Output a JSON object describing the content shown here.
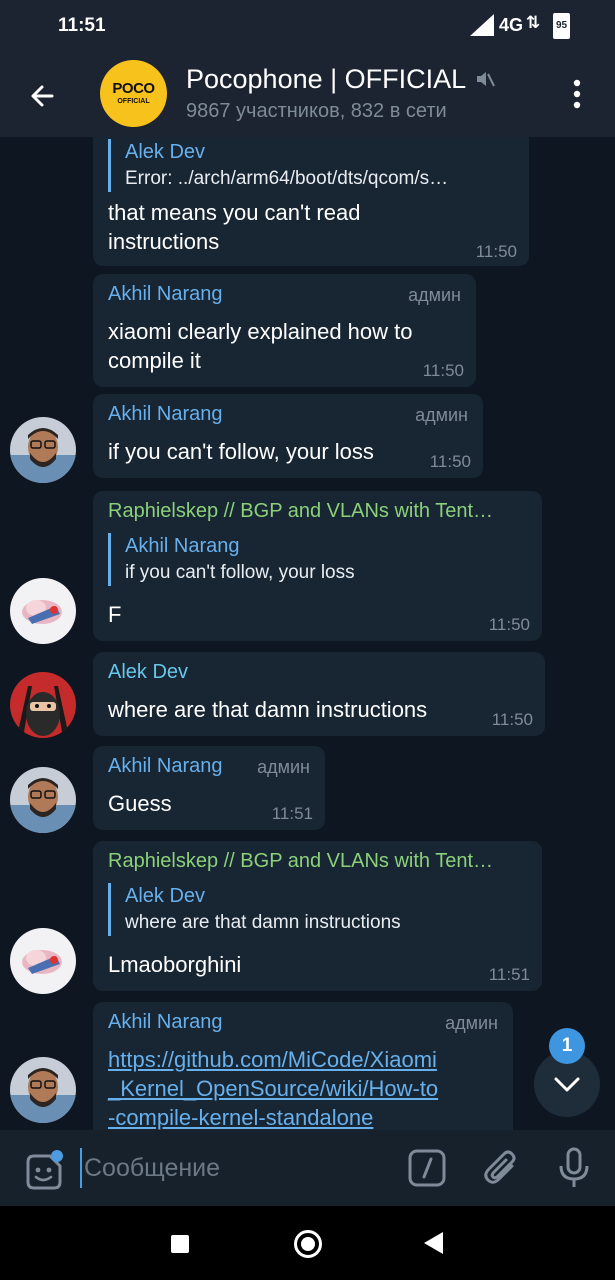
{
  "status_bar": {
    "time": "11:51",
    "network": "4G",
    "battery": "95"
  },
  "header": {
    "title": "Pocophone | OFFICIAL",
    "subtitle": "9867 участников, 832 в сети",
    "avatar_logo": "POCO",
    "avatar_logo_sub": "OFFICIAL",
    "icons": {
      "back": "back-arrow-icon",
      "mute": "mute-icon",
      "more": "more-vertical-icon"
    }
  },
  "messages": [
    {
      "quote_sender": "Alek Dev",
      "quote_text": "Error: ../arch/arm64/boot/dts/qcom/s…",
      "text_line1": "that means you can't read",
      "text_line2": "instructions",
      "time": "11:50"
    },
    {
      "sender": "Akhil Narang",
      "role": "админ",
      "text_line1": "xiaomi clearly explained how to",
      "text_line2": "compile it",
      "time": "11:50"
    },
    {
      "sender": "Akhil Narang",
      "role": "админ",
      "text": "if you can't follow, your loss",
      "time": "11:50"
    },
    {
      "sender": "Raphielskep // BGP and VLANs with Tent…",
      "quote_sender": "Akhil Narang",
      "quote_text": "if you can't follow, your loss",
      "text": "F",
      "time": "11:50"
    },
    {
      "sender": "Alek Dev",
      "text": "where are that damn instructions",
      "time": "11:50"
    },
    {
      "sender": "Akhil Narang",
      "role": "админ",
      "text": "Guess",
      "time": "11:51"
    },
    {
      "sender": "Raphielskep // BGP and VLANs with Tent…",
      "quote_sender": "Alek Dev",
      "quote_text": "where are that damn instructions",
      "text": "Lmaoborghini",
      "time": "11:51"
    },
    {
      "sender": "Akhil Narang",
      "role": "админ",
      "link_line1": "https://github.com/MiCode/Xiaomi",
      "link_line2": "_Kernel_OpenSource/wiki/How-to",
      "link_line3": "-compile-kernel-standalone"
    }
  ],
  "scroll_down": {
    "unread_count": "1"
  },
  "composer": {
    "placeholder": "Сообщение",
    "value": "",
    "icons": {
      "sticker": "sticker-icon",
      "command": "bot-command-icon",
      "attach": "paperclip-icon",
      "mic": "microphone-icon"
    }
  },
  "colors": {
    "background": "#0e1621",
    "header": "#1b2430",
    "bubble": "#182533",
    "accent": "#67b0ec",
    "green_name": "#8bd17a",
    "timestamp": "#7f8b98"
  }
}
